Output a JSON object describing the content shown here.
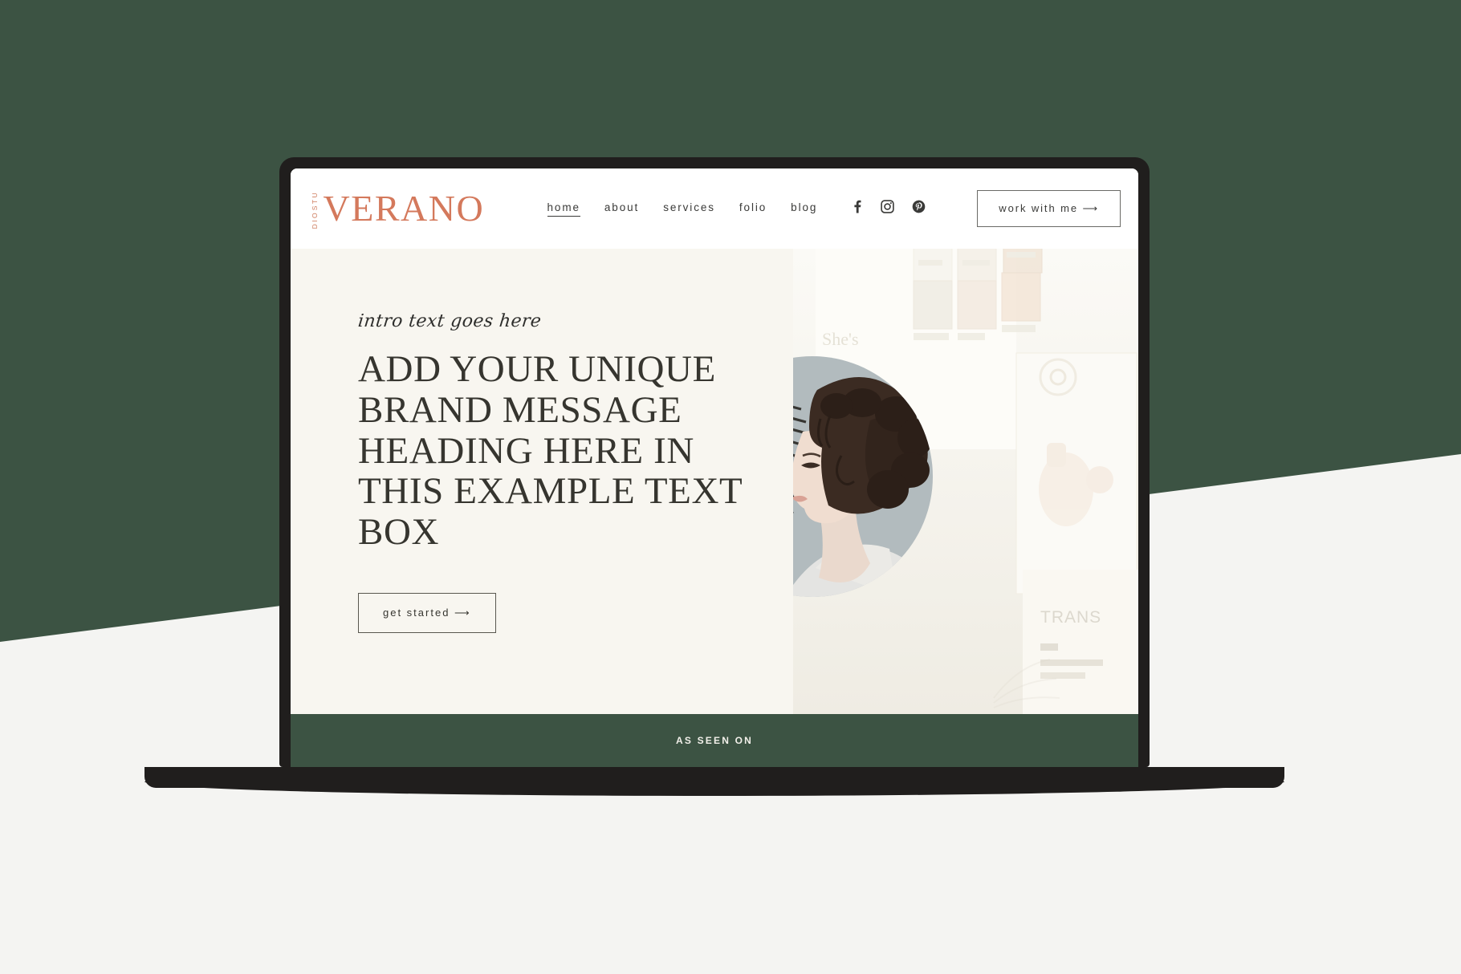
{
  "page": {
    "background_color": "#f4f4f2",
    "accent_green": "#3c5343",
    "accent_terracotta": "#d4795c",
    "screen_cream": "#f8f6f0",
    "frame_dark": "#201e1d"
  },
  "header": {
    "logo": {
      "stack_top": "STU",
      "stack_bottom": "DIO",
      "word": "VERANO"
    },
    "nav": [
      {
        "label": "home",
        "active": true
      },
      {
        "label": "about",
        "active": false
      },
      {
        "label": "services",
        "active": false
      },
      {
        "label": "folio",
        "active": false
      },
      {
        "label": "blog",
        "active": false
      }
    ],
    "socials": [
      {
        "name": "facebook-icon",
        "glyph": "f"
      },
      {
        "name": "instagram-icon",
        "glyph": "▢"
      },
      {
        "name": "pinterest-icon",
        "glyph": "p"
      }
    ],
    "cta": {
      "label": "work with me  ⟶"
    }
  },
  "hero": {
    "intro": "intro text goes here",
    "heading": "ADD YOUR UNIQUE BRAND MESSAGE HEADING HERE IN THIS EXAMPLE TEXT BOX",
    "button": {
      "label": "get started  ⟶"
    },
    "photo": {
      "alt": "woman in profile with curly updo and palm frond, on moodboard wall",
      "circle_color": "#b2bbbe",
      "moodboard_labels": [
        "TRANS"
      ]
    }
  },
  "seen_bar": {
    "label": "AS SEEN ON"
  }
}
